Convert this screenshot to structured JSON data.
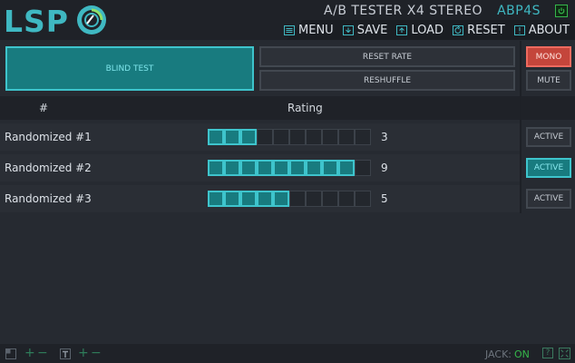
{
  "header": {
    "logo": "LSP",
    "plugin_name": "A/B TESTER X4 STEREO",
    "plugin_id": "ABP4S",
    "menu": [
      {
        "label": "MENU",
        "icon": "menu-icon"
      },
      {
        "label": "SAVE",
        "icon": "save-icon"
      },
      {
        "label": "LOAD",
        "icon": "load-icon"
      },
      {
        "label": "RESET",
        "icon": "reset-icon"
      },
      {
        "label": "ABOUT",
        "icon": "about-icon"
      }
    ]
  },
  "controls": {
    "blind_test": "BLIND TEST",
    "reset_rate": "RESET RATE",
    "reshuffle": "RESHUFFLE",
    "mono": "MONO",
    "mute": "MUTE"
  },
  "table": {
    "col_num": "#",
    "col_rating": "Rating",
    "rows": [
      {
        "label": "Randomized #1",
        "rating": 3,
        "max": 10,
        "active_label": "ACTIVE",
        "active": false
      },
      {
        "label": "Randomized #2",
        "rating": 9,
        "max": 10,
        "active_label": "ACTIVE",
        "active": true
      },
      {
        "label": "Randomized #3",
        "rating": 5,
        "max": 10,
        "active_label": "ACTIVE",
        "active": false
      }
    ]
  },
  "footer": {
    "jack_label": "JACK:",
    "jack_status": "ON",
    "help": "?"
  },
  "colors": {
    "accent": "#3ec4cc",
    "accent_fill": "#187b7f",
    "mono_red": "#c4453b",
    "jack_on": "#35b54a"
  }
}
